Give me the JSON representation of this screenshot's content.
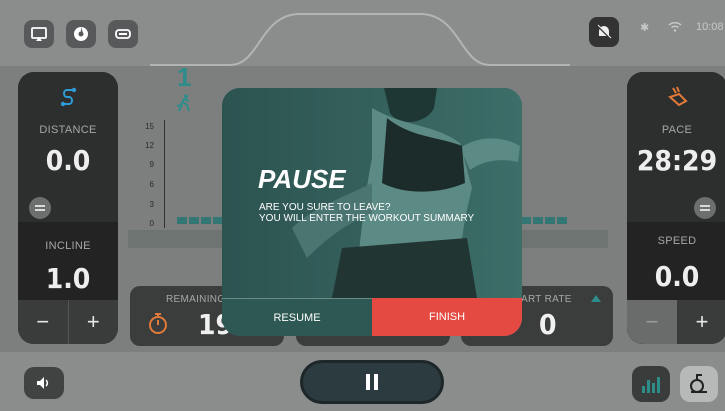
{
  "status": {
    "time": "10:08"
  },
  "left_panel": {
    "distance_label": "DISTANCE",
    "distance_value": "0.0",
    "incline_label": "INCLINE",
    "incline_value": "1.0",
    "minus": "−",
    "plus": "+"
  },
  "right_panel": {
    "pace_label": "PACE",
    "pace_value": "28:29",
    "speed_label": "SPEED",
    "speed_value": "0.0",
    "minus": "−",
    "plus": "+"
  },
  "chart": {
    "level": "1",
    "yticks": [
      "15",
      "12",
      "9",
      "6",
      "3",
      "0"
    ]
  },
  "chart_data": {
    "type": "bar",
    "ylim": [
      0,
      15
    ],
    "values_visible_left": [
      1,
      1,
      1,
      1
    ],
    "values_visible_right": [
      1,
      1,
      1,
      1
    ]
  },
  "metrics": {
    "remaining_label": "REMAINING",
    "remaining_value": "19.",
    "heart_rate_label": "ART RATE",
    "heart_rate_value": "0"
  },
  "modal": {
    "title": "PAUSE",
    "line1": "ARE YOU SURE TO LEAVE?",
    "line2": "YOU WILL ENTER THE WORKOUT SUMMARY",
    "resume": "RESUME",
    "finish": "FINISH"
  },
  "colors": {
    "accent": "#2c8d8a",
    "finish": "#e44a42"
  }
}
